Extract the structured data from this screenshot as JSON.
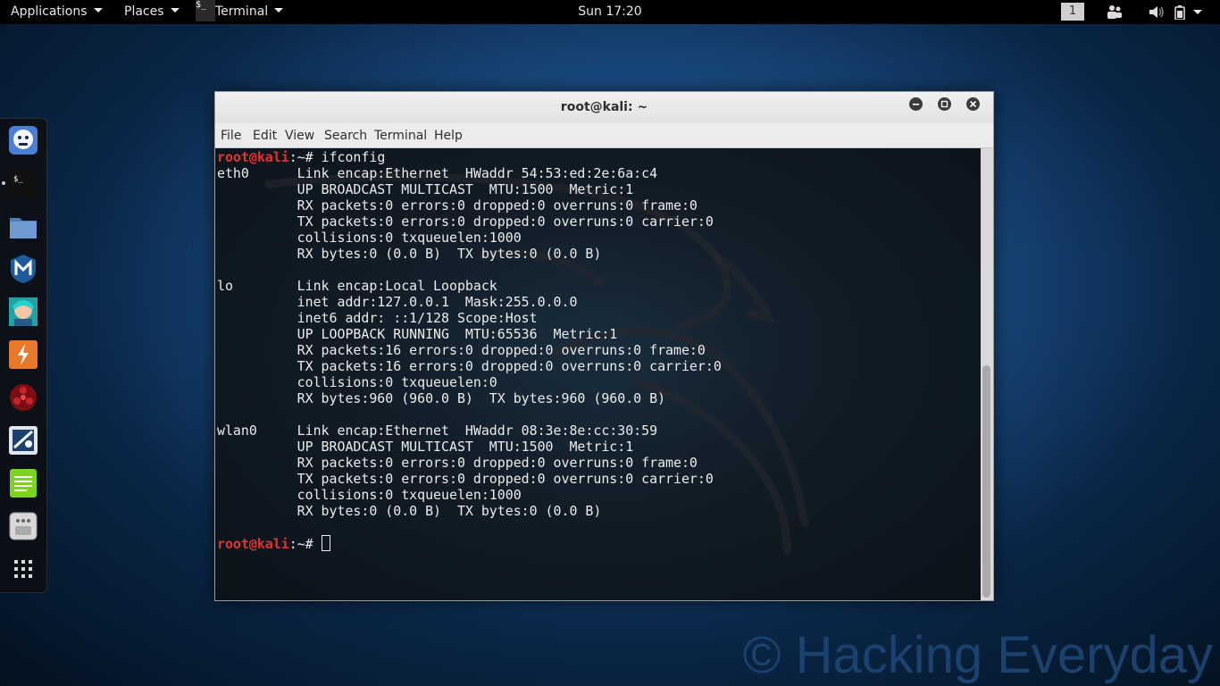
{
  "topbar": {
    "applications": "Applications",
    "places": "Places",
    "terminal_glyph": "$_",
    "terminal": "Terminal",
    "clock": "Sun 17:20",
    "workspace": "1"
  },
  "dock": {
    "items": [
      "kali-dragon-icon",
      "terminal-icon",
      "files-icon",
      "metasploit-icon",
      "armitage-icon",
      "burpsuite-icon",
      "faraday-icon",
      "maltego-icon",
      "leafpad-icon",
      "settings-icon",
      "show-apps-icon"
    ]
  },
  "window": {
    "title": "root@kali: ~",
    "menu": [
      "File",
      "Edit",
      "View",
      "Search",
      "Terminal",
      "Help"
    ]
  },
  "terminal": {
    "prompt_user": "root@kali",
    "prompt_rest": ":~# ",
    "command": "ifconfig",
    "output": "eth0      Link encap:Ethernet  HWaddr 54:53:ed:2e:6a:c4  \n          UP BROADCAST MULTICAST  MTU:1500  Metric:1\n          RX packets:0 errors:0 dropped:0 overruns:0 frame:0\n          TX packets:0 errors:0 dropped:0 overruns:0 carrier:0\n          collisions:0 txqueuelen:1000 \n          RX bytes:0 (0.0 B)  TX bytes:0 (0.0 B)\n\nlo        Link encap:Local Loopback  \n          inet addr:127.0.0.1  Mask:255.0.0.0\n          inet6 addr: ::1/128 Scope:Host\n          UP LOOPBACK RUNNING  MTU:65536  Metric:1\n          RX packets:16 errors:0 dropped:0 overruns:0 frame:0\n          TX packets:16 errors:0 dropped:0 overruns:0 carrier:0\n          collisions:0 txqueuelen:0 \n          RX bytes:960 (960.0 B)  TX bytes:960 (960.0 B)\n\nwlan0     Link encap:Ethernet  HWaddr 08:3e:8e:cc:30:59  \n          UP BROADCAST MULTICAST  MTU:1500  Metric:1\n          RX packets:0 errors:0 dropped:0 overruns:0 frame:0\n          TX packets:0 errors:0 dropped:0 overruns:0 carrier:0\n          collisions:0 txqueuelen:1000 \n          RX bytes:0 (0.0 B)  TX bytes:0 (0.0 B)\n\n",
    "prompt2_user": "root@kali",
    "prompt2_rest": ":~# "
  },
  "watermark": "© Hacking Everyday"
}
